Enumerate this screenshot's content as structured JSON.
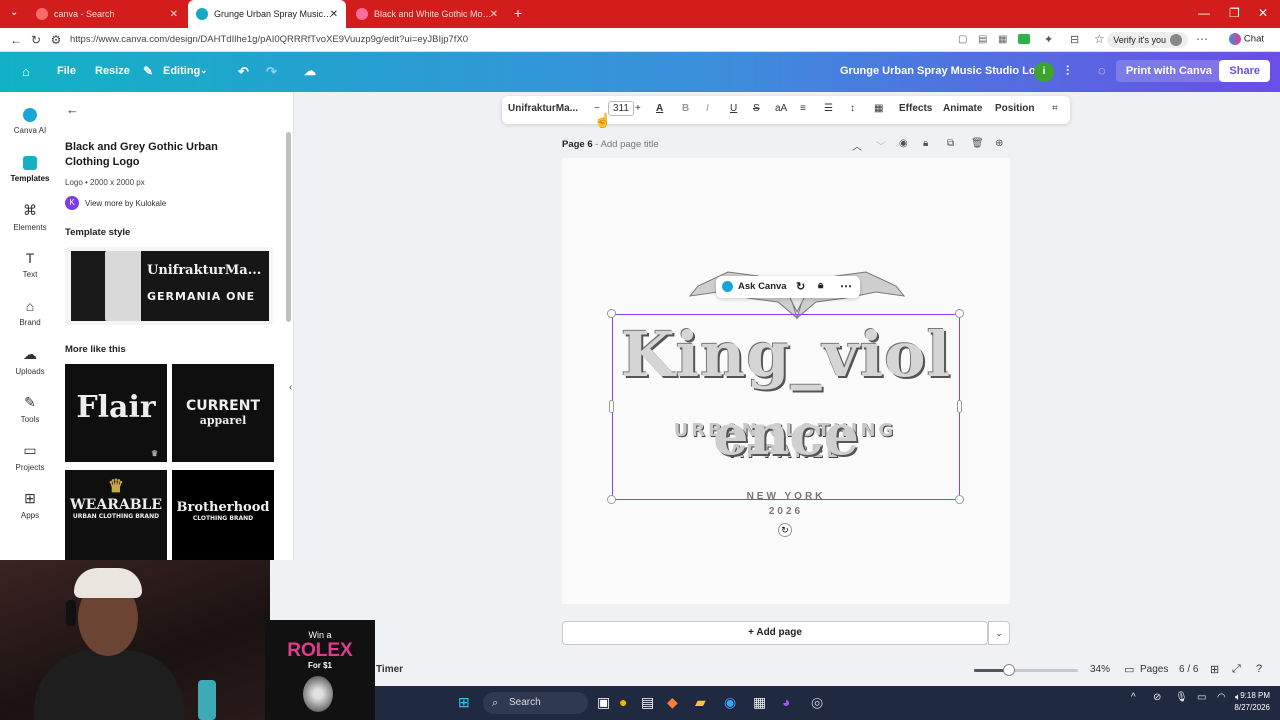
{
  "browser": {
    "tabs": [
      {
        "title": "canva - Search",
        "active": false
      },
      {
        "title": "Grunge Urban Spray Music Studio",
        "active": true
      },
      {
        "title": "Black and White Gothic Modern Urb",
        "active": false
      }
    ],
    "url": "https://www.canva.com/design/DAHTdIlhe1g/pAI0QRRRfTvoXE9Vuuzp9g/edit?ui=eyJBIjp7fX0",
    "verify_label": "Verify it's you",
    "chat_label": "Chat"
  },
  "header": {
    "file_label": "File",
    "resize_label": "Resize",
    "editing_label": "Editing",
    "design_title": "Grunge Urban Spray Music Studio Logo",
    "print_label": "Print with Canva",
    "share_label": "Share",
    "brand_color": "#7d2ae8"
  },
  "rail": {
    "items": [
      {
        "label": "Canva AI",
        "icon": "canva-ai-icon"
      },
      {
        "label": "Templates",
        "icon": "templates-icon"
      },
      {
        "label": "Elements",
        "icon": "elements-icon"
      },
      {
        "label": "Text",
        "icon": "text-icon"
      },
      {
        "label": "Brand",
        "icon": "brand-icon"
      },
      {
        "label": "Uploads",
        "icon": "uploads-icon"
      },
      {
        "label": "Tools",
        "icon": "tools-icon"
      },
      {
        "label": "Projects",
        "icon": "projects-icon"
      },
      {
        "label": "Apps",
        "icon": "apps-icon"
      }
    ]
  },
  "panel": {
    "title": "Black and Grey Gothic Urban Clothing Logo",
    "meta": "Logo • 2000 x 2000 px",
    "author_initial": "K",
    "author_link": "View more by Kulokale",
    "template_style_label": "Template style",
    "font_primary": "UnifrakturMa...",
    "font_secondary": "GERMANIA ONE",
    "more_like_label": "More like this",
    "thumbnails": [
      {
        "line1": "Flair",
        "line2": ""
      },
      {
        "line1": "CURRENT",
        "line2": "apparel"
      },
      {
        "line1": "WEARABLE",
        "line2": "URBAN CLOTHING BRAND"
      },
      {
        "line1": "Brotherhood",
        "line2": "CLOTHING BRAND"
      }
    ]
  },
  "toolbar": {
    "font_name": "UnifrakturMa...",
    "font_size": "311",
    "effects_label": "Effects",
    "animate_label": "Animate",
    "position_label": "Position"
  },
  "page": {
    "label": "Page 6",
    "title_placeholder": "Add page title"
  },
  "design": {
    "line1": "King_viol",
    "line2": "ence",
    "tagline": "URBAN CLOTHING APPAREL",
    "city": "NEW YORK",
    "year": "2026"
  },
  "ask_canva": {
    "label": "Ask Canva"
  },
  "add_page_label": "+ Add page",
  "status": {
    "timer_label": "Timer",
    "zoom": "34%",
    "zoom_level": 0.34,
    "pages_label": "Pages",
    "page_count": "6 / 6"
  },
  "ad": {
    "line1": "Win a",
    "line2": "ROLEX",
    "line3": "For $1"
  },
  "taskbar": {
    "search_label": "Search",
    "time": "9:18 PM",
    "date": "8/27/2026"
  }
}
